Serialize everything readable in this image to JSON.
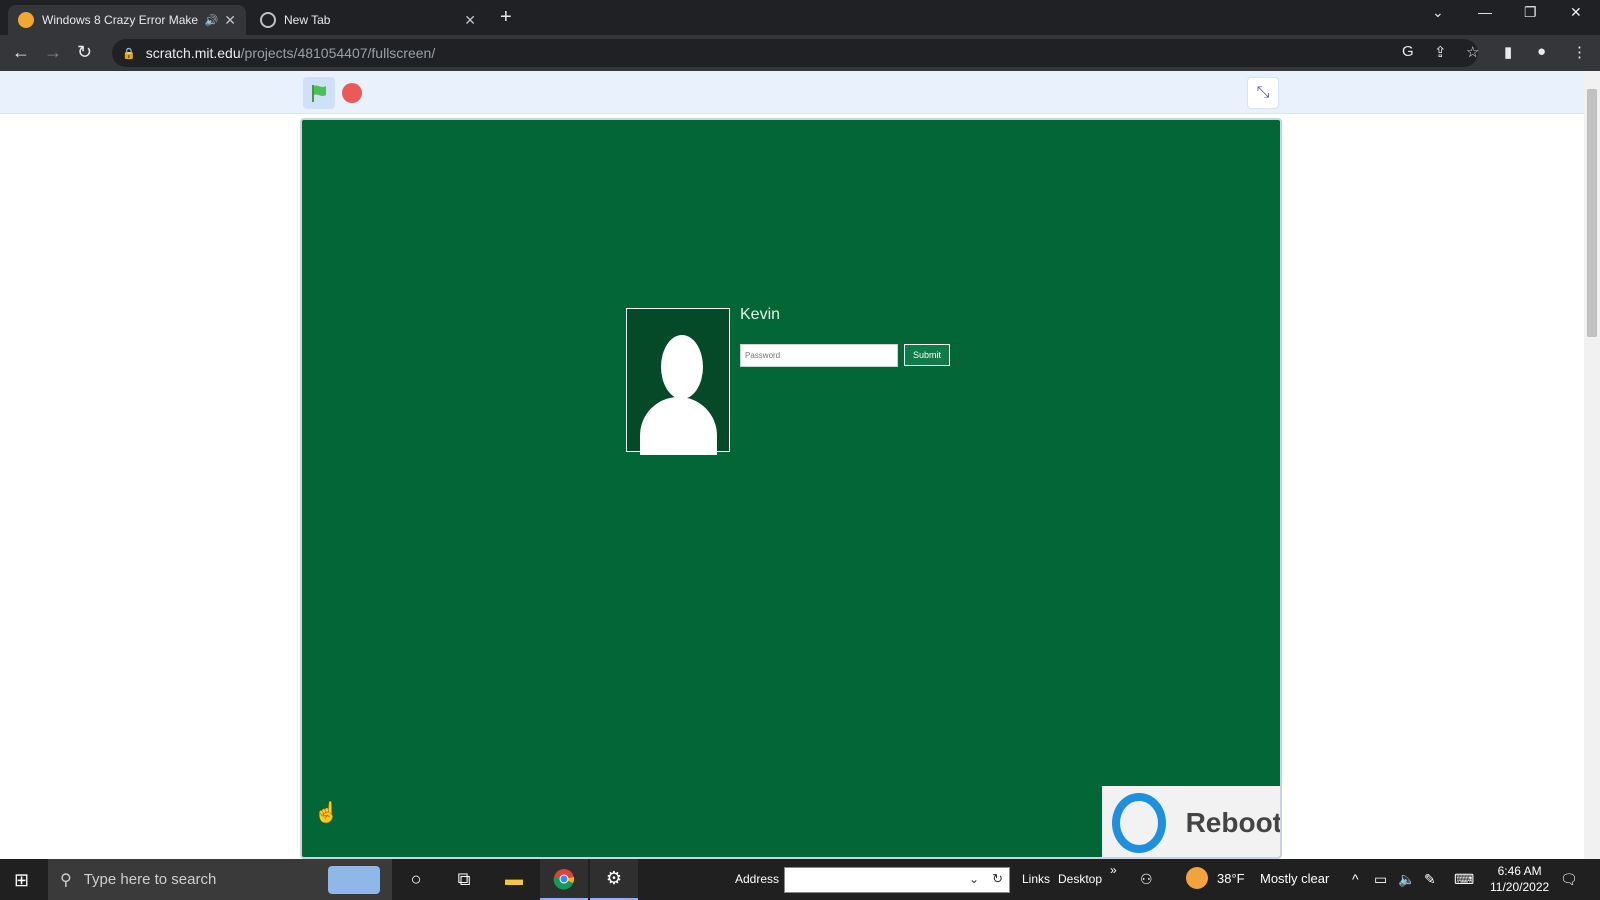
{
  "browser": {
    "tabs": [
      {
        "title": "Windows 8 Crazy Error Make",
        "active": true
      },
      {
        "title": "New Tab",
        "active": false
      }
    ],
    "new_tab": "+",
    "url_host": "scratch.mit.edu",
    "url_path": "/projects/481054407/fullscreen/"
  },
  "stage": {
    "username": "Kevin",
    "password_placeholder": "Password",
    "submit_label": "Submit",
    "reboot_label": "Reboot"
  },
  "taskbar": {
    "search_placeholder": "Type here to search",
    "address_label": "Address",
    "links_label": "Links",
    "desktop_label": "Desktop",
    "more": "»",
    "temperature": "38°F",
    "weather": "Mostly clear",
    "time": "6:46 AM",
    "date": "11/20/2022"
  },
  "colors": {
    "stage_bg": "#036636",
    "taskbar_bg": "#202020",
    "browser_dark": "#202124"
  }
}
